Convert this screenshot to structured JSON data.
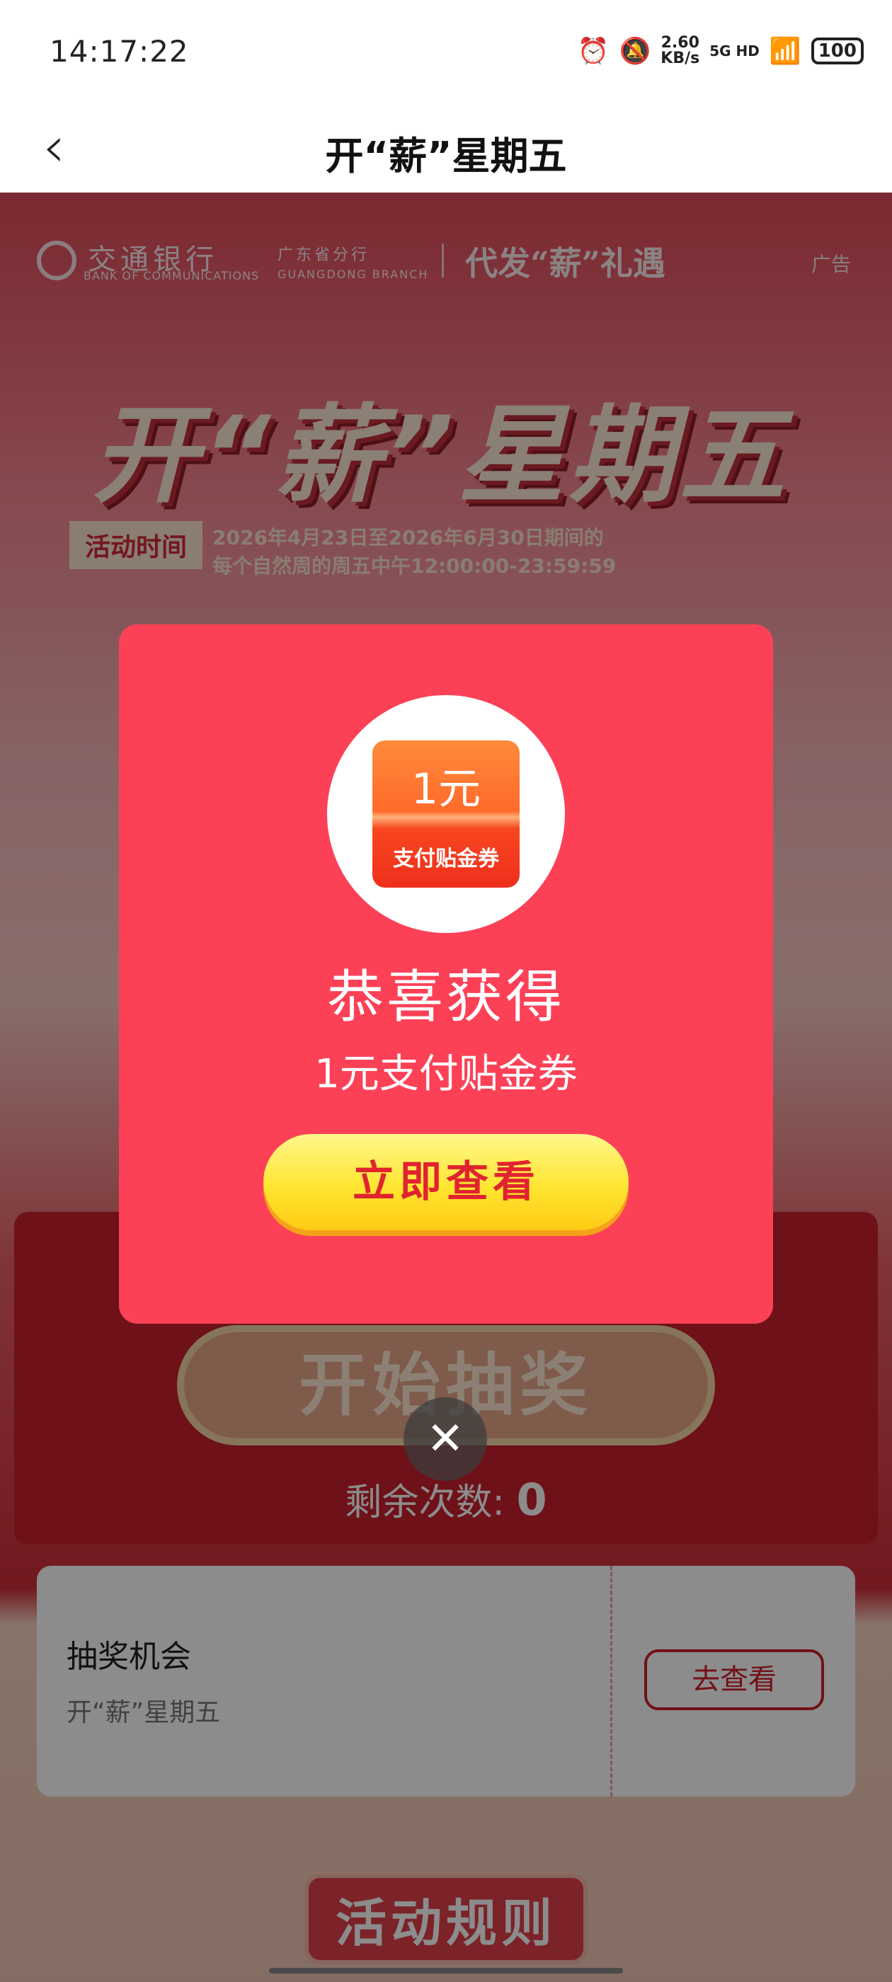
{
  "status_bar": {
    "time": "14:17:22",
    "speed_value": "2.60",
    "speed_unit": "KB/s",
    "network": "5G HD",
    "battery": "100"
  },
  "nav": {
    "back_icon": "‹",
    "title": "开“薪”星期五"
  },
  "banner": {
    "bank_name": "交通银行",
    "bank_name_en": "BANK OF COMMUNICATIONS",
    "branch": "广东省分行",
    "branch_en": "GUANGDONG BRANCH",
    "slogan": "代发“薪”礼遇",
    "ad_label": "广告",
    "title_art": "开“薪”星期五",
    "time_label": "活动时间",
    "time_line1": "2026年4月23日至2026年6月30日期间的",
    "time_line2": "每个自然周的周五中午12:00:00-23:59:59"
  },
  "draw": {
    "button_label": "开始抽奖",
    "remaining_label": "剩余次数:",
    "remaining_count": "0"
  },
  "ticket": {
    "title": "抽奖机会",
    "subtitle": "开“薪”星期五",
    "button_label": "去查看"
  },
  "rules": {
    "button_label": "活动规则"
  },
  "modal": {
    "prize_amount": "1元",
    "prize_type": "支付贴金券",
    "congrats": "恭喜获得",
    "prize_desc": "1元支付贴金券",
    "view_button": "立即查看",
    "close_icon": "✕"
  },
  "colors": {
    "modal_bg": "#fc4157",
    "button_yellow": "#ffe531",
    "brand_red": "#d0202b"
  }
}
